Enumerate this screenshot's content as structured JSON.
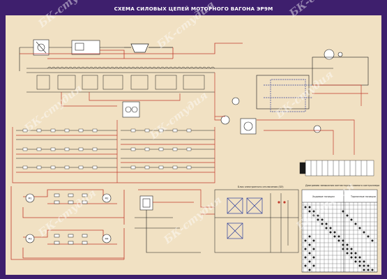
{
  "title": "СХЕМА СИЛОВЫХ ЦЕПЕЙ МОТОРНОГО ВАГОНА ЭР9М",
  "watermark": "БК-студия",
  "panels": {
    "control_block_title": "Блок электронного отключения (БЭ)",
    "contactor_table_title": "Диаграмма замыкания контакторов главного контроллера",
    "table_col_left": "Ходовые позиции",
    "table_col_right": "Тормозные позиции"
  },
  "motors": {
    "m1": "M1",
    "m2": "M2",
    "m3": "M3",
    "m4": "M4"
  },
  "colors": {
    "background": "#3e1f6d",
    "sheet": "#f1e1c3",
    "wire_red": "#c0392b",
    "wire_blue": "#2e3f9c",
    "wire_black": "#1a1a1a",
    "title_text": "#ffffff"
  }
}
